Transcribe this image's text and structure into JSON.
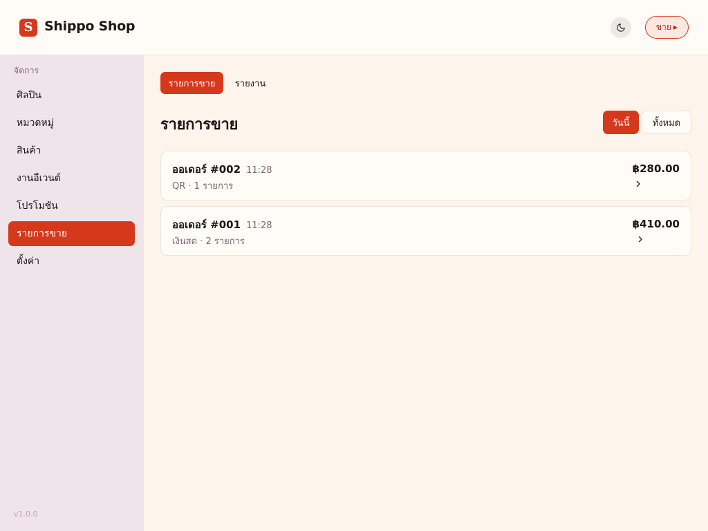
{
  "header": {
    "logo_letter": "S",
    "app_title": "Shippo Shop",
    "theme_toggle_icon": "moon-icon",
    "sell_button_label": "ขาย",
    "sell_button_arrow": "▶"
  },
  "sidebar": {
    "section_label": "จัดการ",
    "items": [
      {
        "label": "ศิลปิน",
        "active": false
      },
      {
        "label": "หมวดหมู่",
        "active": false
      },
      {
        "label": "สินค้า",
        "active": false
      },
      {
        "label": "งานอีเวนต์",
        "active": false
      },
      {
        "label": "โปรโมชัน",
        "active": false
      },
      {
        "label": "รายการขาย",
        "active": true
      },
      {
        "label": "ตั้งค่า",
        "active": false
      }
    ],
    "version": "v1.0.0"
  },
  "tabs": [
    {
      "label": "รายการขาย",
      "active": true
    },
    {
      "label": "รายงาน",
      "active": false
    }
  ],
  "main": {
    "page_title": "รายการขาย",
    "filters": [
      {
        "label": "วันนี้",
        "active": true
      },
      {
        "label": "ทั้งหมด",
        "active": false
      }
    ],
    "orders": [
      {
        "title": "ออเดอร์ #002",
        "time": "11:28",
        "sub": "QR · 1 รายการ",
        "amount": "฿280.00"
      },
      {
        "title": "ออเดอร์ #001",
        "time": "11:28",
        "sub": "เงินสด · 2 รายการ",
        "amount": "฿410.00"
      }
    ]
  },
  "colors": {
    "accent": "#d6381c",
    "sidebar_bg": "#efe4ea",
    "main_bg": "#fdf5ec",
    "header_bg": "#fffcf7"
  }
}
